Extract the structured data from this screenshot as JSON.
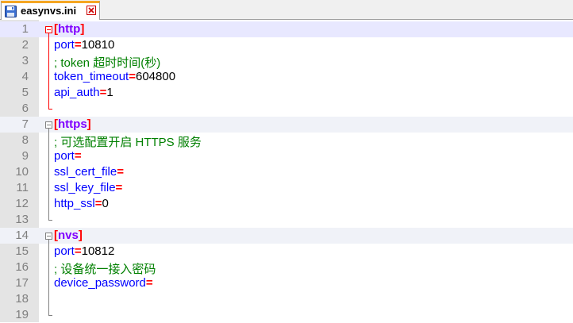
{
  "tab": {
    "filename": "easynvs.ini",
    "colors": {
      "active_border": "#f5a623",
      "close_icon": "#cc0000"
    }
  },
  "editor": {
    "colors": {
      "key": "#0000ff",
      "operator": "#ff0000",
      "comment": "#008000",
      "section": "#8000ff",
      "section_bracket": "#ff0000",
      "gutter_bg": "#e4e4e4",
      "line_number": "#808080"
    },
    "lines": [
      {
        "num": "1",
        "bracket_open": "[",
        "section": "http",
        "bracket_close": "]"
      },
      {
        "num": "2",
        "key": "port",
        "op": "=",
        "value": "10810"
      },
      {
        "num": "3",
        "comment": "; token 超时时间(秒)"
      },
      {
        "num": "4",
        "key": "token_timeout",
        "op": "=",
        "value": "604800"
      },
      {
        "num": "5",
        "key": "api_auth",
        "op": "=",
        "value": "1"
      },
      {
        "num": "6"
      },
      {
        "num": "7",
        "bracket_open": "[",
        "section": "https",
        "bracket_close": "]"
      },
      {
        "num": "8",
        "comment": "; 可选配置开启 HTTPS 服务"
      },
      {
        "num": "9",
        "key": "port",
        "op": "=",
        "value": ""
      },
      {
        "num": "10",
        "key": "ssl_cert_file",
        "op": "=",
        "value": ""
      },
      {
        "num": "11",
        "key": "ssl_key_file",
        "op": "=",
        "value": ""
      },
      {
        "num": "12",
        "key": "http_ssl",
        "op": "=",
        "value": "0"
      },
      {
        "num": "13"
      },
      {
        "num": "14",
        "bracket_open": "[",
        "section": "nvs",
        "bracket_close": "]"
      },
      {
        "num": "15",
        "key": "port",
        "op": "=",
        "value": "10812"
      },
      {
        "num": "16",
        "comment": "; 设备统一接入密码"
      },
      {
        "num": "17",
        "key": "device_password",
        "op": "=",
        "value": ""
      },
      {
        "num": "18"
      },
      {
        "num": "19"
      }
    ]
  }
}
